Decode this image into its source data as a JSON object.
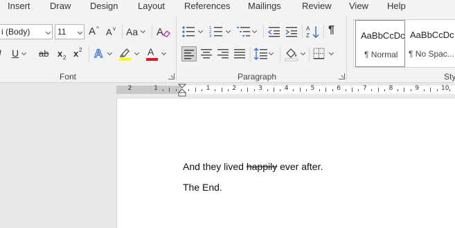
{
  "tabs": [
    "Insert",
    "Draw",
    "Design",
    "Layout",
    "References",
    "Mailings",
    "Review",
    "View",
    "Help"
  ],
  "font_group": {
    "label": "Font",
    "font_name": "Calibri (Body)",
    "font_name_visible": "i (Body)",
    "font_size": "11",
    "grow_font": "A",
    "shrink_font": "A",
    "change_case": "Aa",
    "bold_cut": "I",
    "underline": "U",
    "strikethrough": "ab",
    "subscript": "x",
    "superscript": "x",
    "text_effects": "A",
    "font_color": "A",
    "highlight_color": "#ffff00",
    "font_color_value": "#e81123"
  },
  "paragraph_group": {
    "label": "Paragraph",
    "pilcrow": "¶"
  },
  "styles_group": {
    "label": "Sty",
    "styles": [
      {
        "sample": "AaBbCcDc",
        "name": "¶ Normal",
        "selected": true
      },
      {
        "sample": "AaBbCcDc",
        "name": "¶ No Spac..."
      }
    ]
  },
  "ruler": {
    "left_labels": [
      "2",
      "1"
    ],
    "right_labels": [
      "1",
      "2",
      "3",
      "4",
      "5",
      "6",
      "7",
      "8",
      "9",
      "10"
    ]
  },
  "document": {
    "line1_before": "And they lived ",
    "line1_struck": "happily",
    "line1_after": " ever after.",
    "line2": "The End."
  }
}
